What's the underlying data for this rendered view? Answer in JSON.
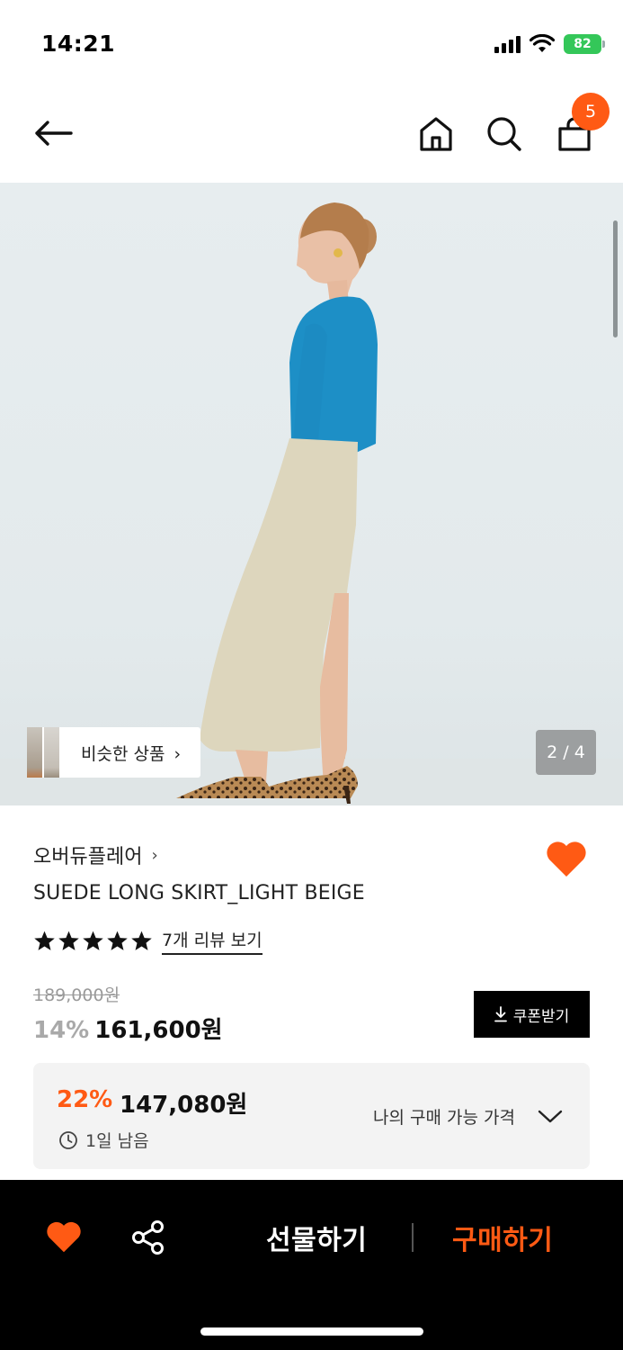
{
  "status_bar": {
    "time": "14:21",
    "battery": "82"
  },
  "nav": {
    "cart_count": "5"
  },
  "gallery": {
    "similar_label": "비슷한 상품",
    "page_counter": "2 / 4"
  },
  "product": {
    "brand": "오버듀플레어",
    "name": "SUEDE LONG SKIRT_LIGHT BEIGE",
    "rating_stars": 5,
    "review_link": "7개 리뷰 보기",
    "original_price": "189,000원",
    "discount_rate": "14%",
    "sale_price": "161,600원",
    "coupon_label": "쿠폰받기"
  },
  "my_price": {
    "discount_rate": "22%",
    "price": "147,080원",
    "time_left": "1일 남음",
    "label": "나의 구매 가능 가격"
  },
  "bottom_bar": {
    "gift_label": "선물하기",
    "buy_label": "구매하기"
  },
  "colors": {
    "accent": "#ff5a14",
    "black": "#000000",
    "battery": "#34c759"
  }
}
